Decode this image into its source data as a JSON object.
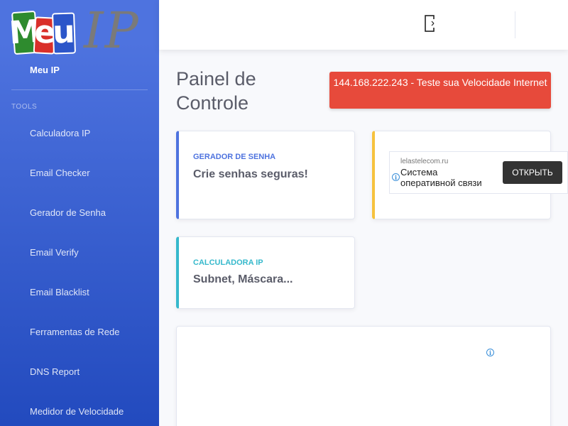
{
  "brand": {
    "name": "Meu IP",
    "logo_letters": [
      "M",
      "e",
      "u"
    ],
    "logo_ip": "IP"
  },
  "sidebar": {
    "heading": "TOOLS",
    "items": [
      {
        "label": "Calculadora IP"
      },
      {
        "label": "Email Checker"
      },
      {
        "label": "Gerador de Senha"
      },
      {
        "label": "Email Verify"
      },
      {
        "label": "Email Blacklist"
      },
      {
        "label": "Ferramentas de Rede"
      },
      {
        "label": "DNS Report"
      },
      {
        "label": "Medidor de Velocidade"
      }
    ]
  },
  "topbar": {
    "icon": "door-exit-icon"
  },
  "main": {
    "title": "Painel de Controle",
    "speed_button": "144.168.222.243 - Teste sua Velocidade Internet",
    "cards": {
      "password": {
        "label": "GERADOR DE SENHA",
        "value": "Crie senhas seguras!"
      },
      "calculator": {
        "label": "CALCULADORA IP",
        "value": "Subnet, Máscara..."
      }
    },
    "ad": {
      "domain": "lelastelecom.ru",
      "text": "Система оперативной связи",
      "button": "ОТКРЫТЬ",
      "info_glyph": "i"
    }
  },
  "colors": {
    "sidebar": "#4e73df",
    "primary": "#4e73df",
    "warning": "#f6c23e",
    "info": "#36b9cc",
    "danger": "#e74a3b"
  }
}
